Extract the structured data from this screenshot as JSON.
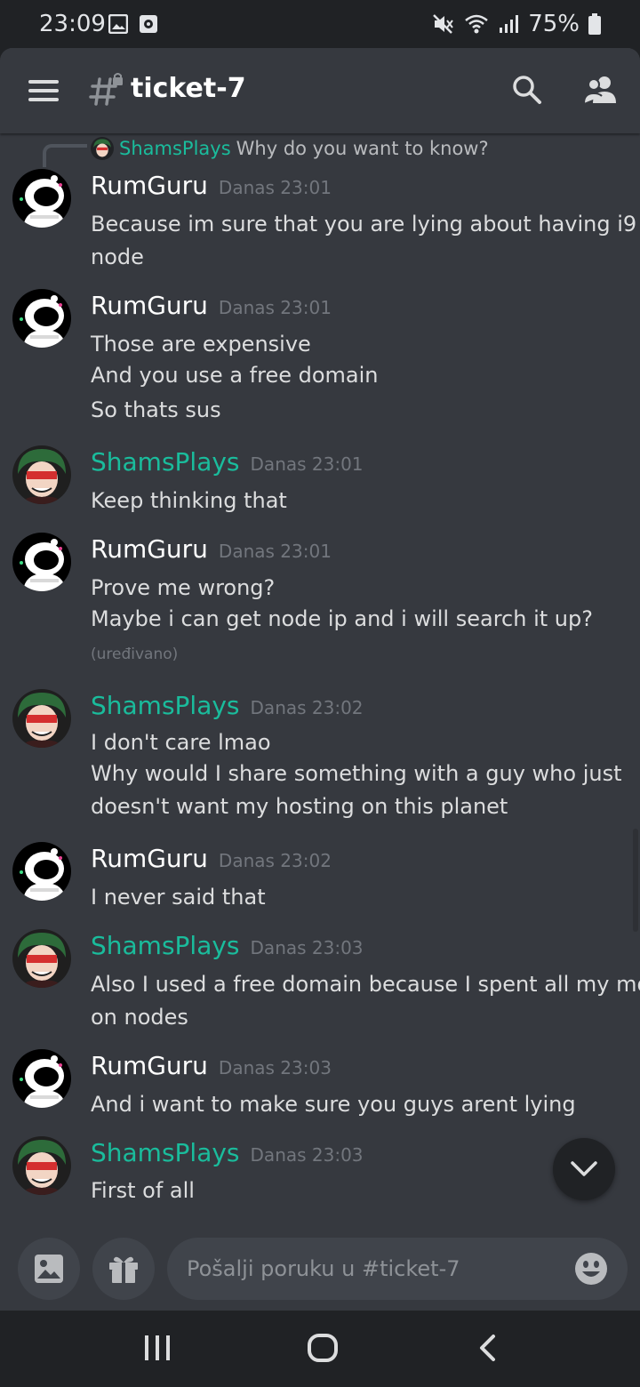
{
  "status_bar": {
    "time": "23:09",
    "battery": "75%"
  },
  "header": {
    "channel": "ticket-7"
  },
  "reply_preview": {
    "author": "ShamsPlays",
    "text": "Why do you want to know?"
  },
  "messages": [
    {
      "author": "RumGuru",
      "time": "Danas 23:01",
      "lines": [
        "Because im sure that you are lying about having i9",
        "node"
      ]
    },
    {
      "author": "RumGuru",
      "time": "Danas 23:01",
      "lines": [
        "Those are expensive",
        "And you use a free domain",
        "So thats sus"
      ]
    },
    {
      "author": "ShamsPlays",
      "time": "Danas 23:01",
      "lines": [
        "Keep thinking that"
      ]
    },
    {
      "author": "RumGuru",
      "time": "Danas 23:01",
      "lines": [
        "Prove me wrong?",
        "Maybe i can get node ip and i will search it up?"
      ],
      "edited": "(uređivano)"
    },
    {
      "author": "ShamsPlays",
      "time": "Danas 23:02",
      "lines": [
        "I don't care lmao",
        "Why would I share something with a guy who just",
        "doesn't want my hosting on this planet"
      ]
    },
    {
      "author": "RumGuru",
      "time": "Danas 23:02",
      "lines": [
        "I never said that"
      ]
    },
    {
      "author": "ShamsPlays",
      "time": "Danas 23:03",
      "lines": [
        "Also I used a free domain because I spent all my money",
        "on nodes"
      ]
    },
    {
      "author": "RumGuru",
      "time": "Danas 23:03",
      "lines": [
        "And i want to make sure you guys arent lying"
      ]
    },
    {
      "author": "ShamsPlays",
      "time": "Danas 23:03",
      "lines": [
        "First of all"
      ]
    }
  ],
  "composer": {
    "placeholder": "Pošalji poruku u #ticket-7"
  },
  "colors": {
    "background": "#36393f",
    "shams_name": "#1abc9c",
    "text": "#dcddde",
    "timestamp": "#72767d"
  }
}
